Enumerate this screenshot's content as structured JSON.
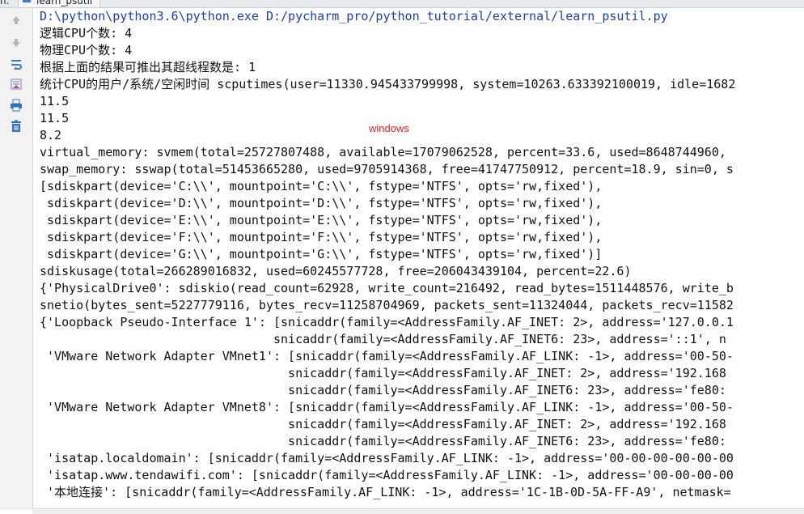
{
  "header": {
    "run_label": "n:",
    "tab_title": "learn_psutil"
  },
  "console": {
    "lines": [
      "D:\\python\\python3.6\\python.exe D:/pycharm_pro/python_tutorial/external/learn_psutil.py",
      "逻辑CPU个数: 4",
      "物理CPU个数: 4",
      "根据上面的结果可推出其超线程数是: 1",
      "统计CPU的用户/系统/空闲时间 scputimes(user=11330.945433799998, system=10263.633392100019, idle=1682",
      "11.5",
      "11.5",
      "8.2",
      "virtual_memory: svmem(total=25727807488, available=17079062528, percent=33.6, used=8648744960,",
      "swap_memory: sswap(total=51453665280, used=9705914368, free=41747750912, percent=18.9, sin=0, s",
      "[sdiskpart(device='C:\\\\', mountpoint='C:\\\\', fstype='NTFS', opts='rw,fixed'),",
      " sdiskpart(device='D:\\\\', mountpoint='D:\\\\', fstype='NTFS', opts='rw,fixed'),",
      " sdiskpart(device='E:\\\\', mountpoint='E:\\\\', fstype='NTFS', opts='rw,fixed'),",
      " sdiskpart(device='F:\\\\', mountpoint='F:\\\\', fstype='NTFS', opts='rw,fixed'),",
      " sdiskpart(device='G:\\\\', mountpoint='G:\\\\', fstype='NTFS', opts='rw,fixed')]",
      "sdiskusage(total=266289016832, used=60245577728, free=206043439104, percent=22.6)",
      "{'PhysicalDrive0': sdiskio(read_count=62928, write_count=216492, read_bytes=1511448576, write_b",
      "snetio(bytes_sent=5227779116, bytes_recv=11258704969, packets_sent=11324044, packets_recv=11582",
      "{'Loopback Pseudo-Interface 1': [snicaddr(family=<AddressFamily.AF_INET: 2>, address='127.0.0.1",
      "                                snicaddr(family=<AddressFamily.AF_INET6: 23>, address='::1', n",
      " 'VMware Network Adapter VMnet1': [snicaddr(family=<AddressFamily.AF_LINK: -1>, address='00-50-",
      "                                  snicaddr(family=<AddressFamily.AF_INET: 2>, address='192.168",
      "                                  snicaddr(family=<AddressFamily.AF_INET6: 23>, address='fe80:",
      " 'VMware Network Adapter VMnet8': [snicaddr(family=<AddressFamily.AF_LINK: -1>, address='00-50-",
      "                                  snicaddr(family=<AddressFamily.AF_INET: 2>, address='192.168",
      "                                  snicaddr(family=<AddressFamily.AF_INET6: 23>, address='fe80:",
      " 'isatap.localdomain': [snicaddr(family=<AddressFamily.AF_LINK: -1>, address='00-00-00-00-00-00",
      " 'isatap.www.tendawifi.com': [snicaddr(family=<AddressFamily.AF_LINK: -1>, address='00-00-00-00",
      " '本地连接': [snicaddr(family=<AddressFamily.AF_LINK: -1>, address='1C-1B-0D-5A-FF-A9', netmask="
    ]
  },
  "overlay": {
    "text": "windows",
    "color": "#e0201c"
  },
  "toolbar": {
    "icons": [
      "arrow-up-icon",
      "arrow-down-icon",
      "soft-wrap-icon",
      "scroll-to-end-icon",
      "print-icon",
      "trash-icon"
    ]
  },
  "colors": {
    "command": "#1b3eb0",
    "output": "#111111",
    "accent": "#3a7bd5"
  }
}
